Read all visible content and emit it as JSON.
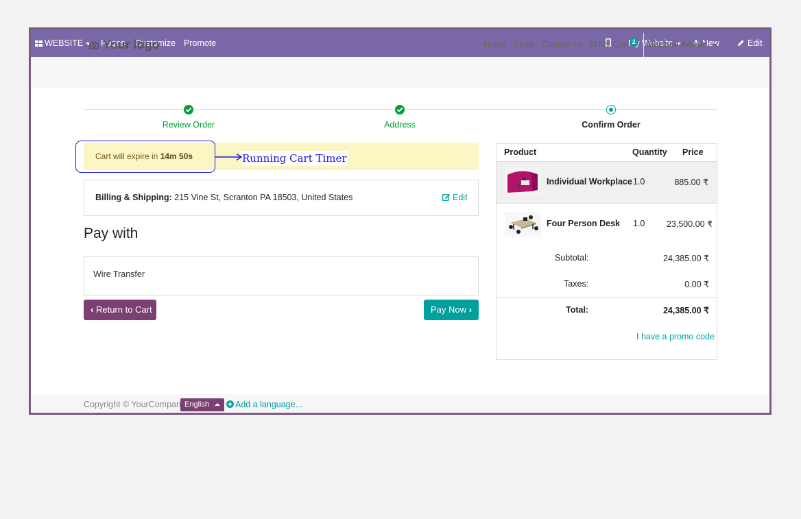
{
  "adminbar": {
    "website_menu": "WEBSITE",
    "pages": "Pages",
    "customize": "Customize",
    "promote": "Promote",
    "my_website": "My Website",
    "new": "New",
    "edit": "Edit"
  },
  "header": {
    "logo": "Your logo",
    "nav": [
      "Home",
      "Shop",
      "Contact us"
    ],
    "cart_label": "My Cart",
    "cart_count": "2",
    "user": "Mitchell Admin"
  },
  "progress": {
    "steps": [
      {
        "label": "Review Order",
        "state": "done"
      },
      {
        "label": "Address",
        "state": "done"
      },
      {
        "label": "Confirm Order",
        "state": "current"
      }
    ],
    "done_color": "#00a035",
    "current_color": "#00a09d"
  },
  "timer": {
    "prefix": "Cart will expire in",
    "value": "14m 50s",
    "annotation": "Running Cart Timer"
  },
  "billing": {
    "label": "Billing & Shipping:",
    "address": "215 Vine St, Scranton PA 18503, United States",
    "edit_label": "Edit"
  },
  "payment": {
    "heading": "Pay with",
    "method": "Wire Transfer",
    "return_label": "Return to Cart",
    "pay_label": "Pay Now"
  },
  "order": {
    "headers": {
      "product": "Product",
      "quantity": "Quantity",
      "price": "Price"
    },
    "lines": [
      {
        "name": "Individual Workplace",
        "qty": "1.0",
        "price": "885.00 ₹"
      },
      {
        "name": "Four Person Desk",
        "qty": "1.0",
        "price": "23,500.00 ₹"
      }
    ],
    "subtotal_label": "Subtotal:",
    "subtotal": "24,385.00 ₹",
    "taxes_label": "Taxes:",
    "taxes": "0.00 ₹",
    "total_label": "Total:",
    "total": "24,385.00 ₹",
    "promo": "I have a promo code"
  },
  "footer": {
    "copyright": "Copyright © YourCompany",
    "language": "English",
    "add_language": "Add a language..."
  },
  "colors": {
    "adminbar": "#7b68a8",
    "primary": "#7c3f73",
    "accent": "#00a09d"
  }
}
